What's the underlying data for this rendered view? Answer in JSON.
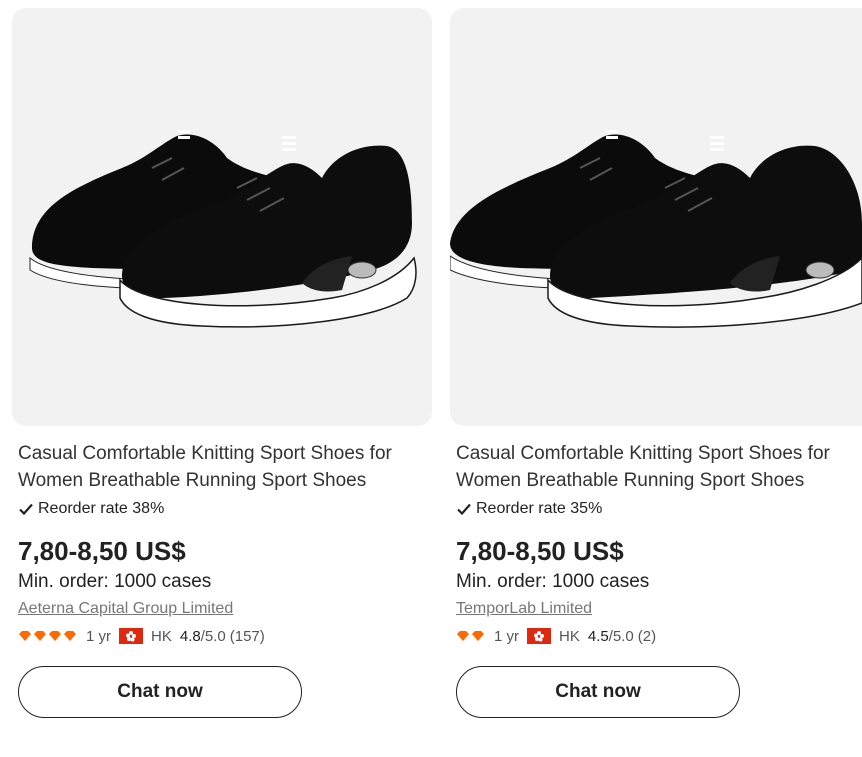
{
  "products": [
    {
      "title": "Casual Comfortable Knitting Sport Shoes for Women Breathable Running Sport Shoes",
      "reorder_label": "Reorder rate 38%",
      "price": "7,80-8,50 US$",
      "min_order": "Min. order: 1000 cases",
      "supplier": "Aeterna Capital Group Limited",
      "diamonds": 4,
      "years": "1 yr",
      "country": "HK",
      "rating": "4.8",
      "rating_max": "/5.0",
      "reviews": "(157)",
      "chat_label": "Chat now"
    },
    {
      "title": "Casual Comfortable Knitting Sport Shoes for Women Breathable Running Sport Shoes",
      "reorder_label": "Reorder rate 35%",
      "price": "7,80-8,50 US$",
      "min_order": "Min. order: 1000 cases",
      "supplier": "TemporLab Limited",
      "diamonds": 2,
      "years": "1 yr",
      "country": "HK",
      "rating": "4.5",
      "rating_max": "/5.0",
      "reviews": "(2)",
      "chat_label": "Chat now"
    }
  ],
  "colors": {
    "diamond": "#ff6a00",
    "flag": "#de2910",
    "image_bg": "#f2f2f2"
  }
}
